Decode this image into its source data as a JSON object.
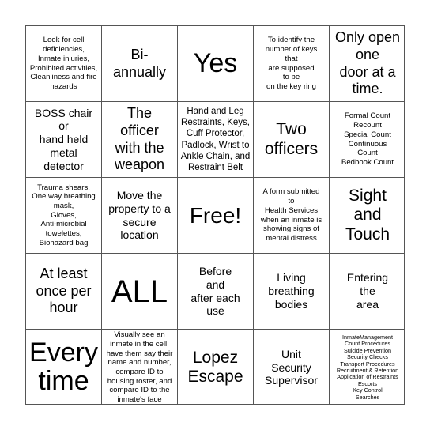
{
  "board": {
    "cells": [
      {
        "text": "Look for cell\ndeficiencies,\nInmate injuries,\nProhibited activities,\nCleanliness and fire\nhazards"
      },
      {
        "text": "Bi-\nannually"
      },
      {
        "text": "Yes"
      },
      {
        "text": "To identify the\nnumber of keys\nthat\nare supposed\nto be\non the key ring"
      },
      {
        "text": "Only open\none\ndoor at a\ntime."
      },
      {
        "text": "BOSS chair\nor\nhand held\nmetal\ndetector"
      },
      {
        "text": "The\nofficer\nwith the\nweapon"
      },
      {
        "text": "Hand and Leg\nRestraints, Keys,\nCuff Protector,\nPadlock, Wrist to\nAnkle Chain, and\nRestraint Belt"
      },
      {
        "text": "Two\nofficers"
      },
      {
        "text": "Formal Count\nRecount\nSpecial Count\nContinuous\nCount\nBedbook Count"
      },
      {
        "text": "Trauma shears,\nOne way breathing\nmask,\nGloves,\nAnti-microbial\ntowelettes,\nBiohazard bag"
      },
      {
        "text": "Move the\nproperty to a\nsecure\nlocation"
      },
      {
        "text": "Free!"
      },
      {
        "text": "A form submitted\nto\nHealth Services\nwhen an inmate is\nshowing signs of\nmental distress"
      },
      {
        "text": "Sight\nand\nTouch"
      },
      {
        "text": "At least\nonce per\nhour"
      },
      {
        "text": "ALL"
      },
      {
        "text": "Before\nand\nafter each\nuse"
      },
      {
        "text": "Living\nbreathing\nbodies"
      },
      {
        "text": "Entering\nthe\narea"
      },
      {
        "text": "Every\ntime"
      },
      {
        "text": "Visually see an\ninmate in the cell,\nhave them say their\nname and number,\ncompare ID to\nhousing roster, and\ncompare ID to the\ninmate's face"
      },
      {
        "text": "Lopez\nEscape"
      },
      {
        "text": "Unit\nSecurity\nSupervisor"
      },
      {
        "text": "InmateManagement\nCount Procedures\nSuicide Prevention\nSecurity Checks\nTransport Procedures\nRecruitment & Retention\nApplication of Restraints\nEscorts\nKey Control\nSearches"
      }
    ]
  }
}
